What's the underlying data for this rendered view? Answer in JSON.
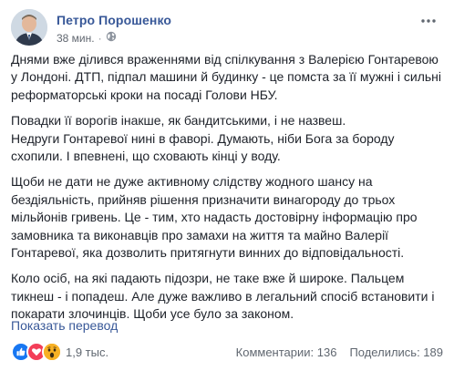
{
  "post": {
    "author": "Петро Порошенко",
    "time": "38 мин.",
    "separator": "·",
    "privacy_icon": "globe-icon",
    "more_icon": "more-options-icon",
    "paragraphs": [
      [
        "Днями вже ділився враженнями від спілкування з Валерією Гонтаревою",
        "у Лондоні. ДТП, підпал машини й будинку - це помста за її мужні і сильні",
        "реформаторські кроки на посаді Голови НБУ."
      ],
      [
        "Повадки її ворогів інакше, як бандитськими, і не назвеш.",
        "Недруги Гонтаревої нині в фаворі. Думають, ніби Бога за бороду",
        "схопили. І впевнені, що сховають кінці у воду."
      ],
      [
        "Щоби не дати не дуже активному слідству жодного шансу на",
        "бездіяльність, прийняв рішення призначити винагороду до трьох",
        "мільйонів гривень. Це - тим, хто надасть достовірну інформацію про",
        "замовника та виконавців про замахи на життя та майно Валерії",
        "Гонтаревої, яка дозволить притягнути винних до відповідальності."
      ],
      [
        "Коло осіб, на які падають підозри, не таке вже й широке. Пальцем",
        "тикнеш - і попадеш. Але дуже важливо в легальний спосіб встановити і",
        "покарати злочинців. Щоби усе було за законом."
      ]
    ],
    "translate_label": "Показать перевод"
  },
  "footer": {
    "reactions": [
      "like-icon",
      "love-icon",
      "wow-icon"
    ],
    "reaction_count": "1,9 тыс.",
    "comments_label": "Комментарии: 136",
    "shares_label": "Поделились: 189"
  },
  "colors": {
    "link": "#385898",
    "text": "#1d2129",
    "meta": "#616770",
    "like": "#1877f2",
    "love": "#f33e58",
    "wow": "#f7b125"
  }
}
